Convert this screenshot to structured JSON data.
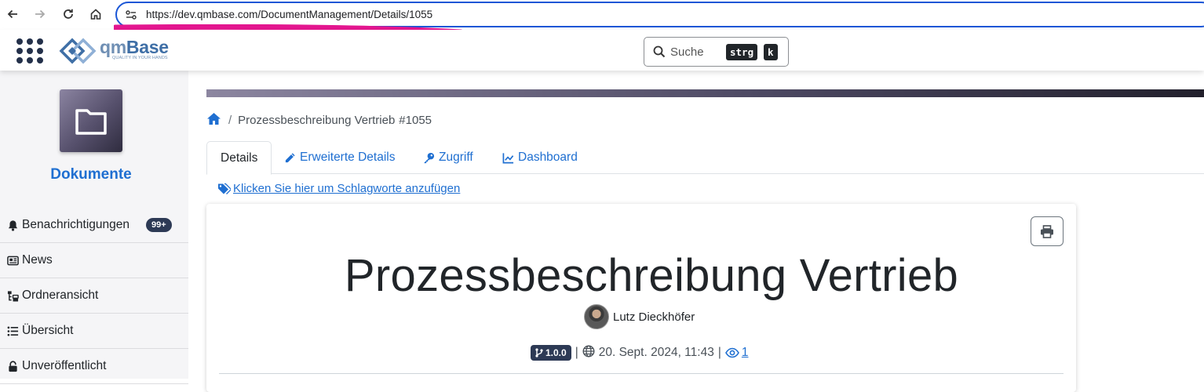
{
  "browser": {
    "url": "https://dev.qmbase.com/DocumentManagement/Details/1055",
    "icons": [
      "back-arrow-icon",
      "forward-arrow-icon",
      "reload-icon",
      "home-icon",
      "site-settings-icon"
    ]
  },
  "header": {
    "logo_text_qm": "qm",
    "logo_text_base": "Base",
    "logo_tagline": "QUALITY IN YOUR HANDS",
    "search_placeholder": "Suche",
    "shortcut_key1": "strg",
    "shortcut_key2": "k"
  },
  "sidebar": {
    "title": "Dokumente",
    "items": [
      {
        "label": "Benachrichtigungen",
        "icon": "bell-icon",
        "badge": "99+"
      },
      {
        "label": "News",
        "icon": "newspaper-icon"
      },
      {
        "label": "Ordneransicht",
        "icon": "folder-tree-icon"
      },
      {
        "label": "Übersicht",
        "icon": "list-icon"
      },
      {
        "label": "Unveröffentlicht",
        "icon": "lock-open-icon"
      }
    ]
  },
  "breadcrumb": {
    "current": "Prozessbeschreibung Vertrieb",
    "id_suffix": "#1055"
  },
  "tabs": [
    {
      "label": "Details",
      "active": true
    },
    {
      "label": "Erweiterte Details",
      "icon": "pencil-icon"
    },
    {
      "label": "Zugriff",
      "icon": "key-icon"
    },
    {
      "label": "Dashboard",
      "icon": "chart-line-icon"
    }
  ],
  "tags_link": "Klicken Sie hier um Schlagworte anzufügen",
  "document": {
    "title": "Prozessbeschreibung Vertrieb",
    "author": "Lutz Dieckhöfer",
    "version": "1.0.0",
    "date": "20. Sept. 2024, 11:43",
    "views": "1"
  },
  "colors": {
    "accent_blue": "#1f6fd1",
    "badge_navy": "#2d3a55",
    "annotation_pink": "#e3168f"
  }
}
